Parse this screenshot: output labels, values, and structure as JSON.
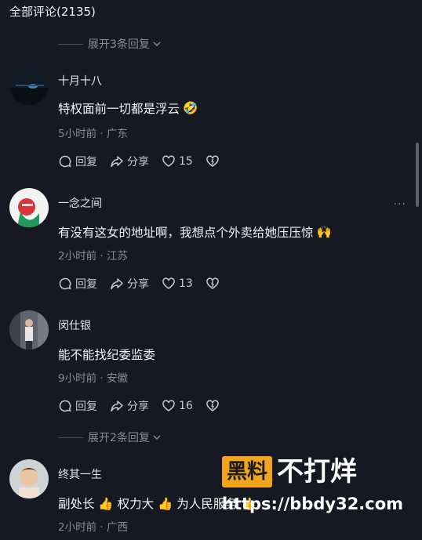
{
  "header": {
    "title": "全部评论(2135)"
  },
  "expand_top": {
    "label": "展开3条回复"
  },
  "expand_bottom": {
    "label": "展开2条回复"
  },
  "comments": [
    {
      "username": "十月十八",
      "text": "特权面前一切都是浮云",
      "emoji": "🤣",
      "meta": "5小时前 · 广东",
      "reply": "回复",
      "share": "分享",
      "likes": "15"
    },
    {
      "username": "一念之间",
      "text": "有没有这女的地址啊，我想点个外卖给她压压惊",
      "emoji": "🙌",
      "meta": "2小时前 · 江苏",
      "reply": "回复",
      "share": "分享",
      "likes": "13",
      "more": "···"
    },
    {
      "username": "闵仕银",
      "text": "能不能找纪委监委",
      "emoji": "",
      "meta": "9小时前 · 安徽",
      "reply": "回复",
      "share": "分享",
      "likes": "16"
    },
    {
      "username": "终其一生",
      "text": "副处长 👍 权力大 👍 为人民服务 👍",
      "emoji": "",
      "meta": "2小时前 · 广西"
    }
  ],
  "watermark": {
    "brand": "黑料",
    "slogan": "不打烊",
    "url": "https://bbdy32.com"
  },
  "icons": [
    "reply-icon",
    "share-icon",
    "heart-icon",
    "dislike-icon",
    "chevron-down-icon"
  ]
}
